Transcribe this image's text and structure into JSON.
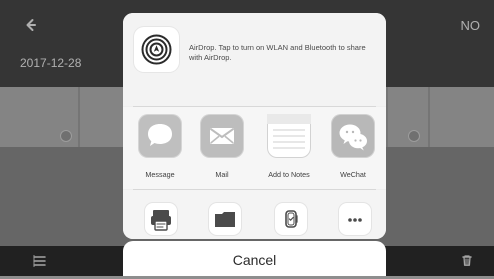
{
  "background": {
    "date_label": "2017-12-28",
    "header_right_label": "NO"
  },
  "share_sheet": {
    "airdrop_text": "AirDrop. Tap to turn on WLAN and Bluetooth to share with AirDrop.",
    "apps": [
      {
        "label": "Message",
        "icon": "message-icon"
      },
      {
        "label": "Mail",
        "icon": "mail-icon"
      },
      {
        "label": "Add to Notes",
        "icon": "notes-icon"
      },
      {
        "label": "WeChat",
        "icon": "wechat-icon"
      }
    ],
    "actions": [
      {
        "icon": "print-icon"
      },
      {
        "icon": "folder-icon"
      },
      {
        "icon": "watch-icon"
      },
      {
        "icon": "more-icon"
      }
    ],
    "cancel_label": "Cancel"
  }
}
